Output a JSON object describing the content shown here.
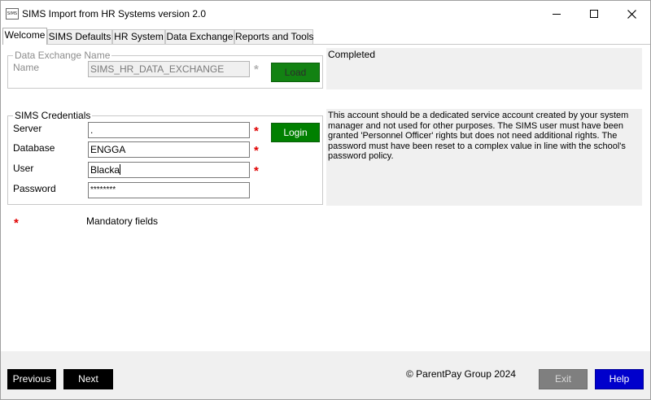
{
  "window": {
    "icon_text": "SIMS",
    "title": "SIMS Import from HR Systems  version 2.0"
  },
  "tabs": [
    {
      "label": "Welcome",
      "active": true
    },
    {
      "label": "SIMS Defaults",
      "active": false
    },
    {
      "label": "HR System",
      "active": false
    },
    {
      "label": "Data Exchange",
      "active": false
    },
    {
      "label": "Reports and Tools",
      "active": false
    }
  ],
  "data_exchange": {
    "legend": "Data Exchange Name",
    "name_label": "Name",
    "name_value": "SIMS_HR_DATA_EXCHANGE",
    "load_label": "Load",
    "status": "Completed"
  },
  "credentials": {
    "legend": "SIMS Credentials",
    "server_label": "Server",
    "server_value": ".",
    "database_label": "Database",
    "database_value": "ENGGA",
    "user_label": "User",
    "user_value": "Blacka",
    "password_label": "Password",
    "password_value": "********",
    "login_label": "Login",
    "info": "This account should be a dedicated service account created by your system manager and not used for other purposes. The SIMS user must have been granted 'Personnel Officer' rights but does not need additional rights. The password must have been reset to a complex value in line with the school's password policy."
  },
  "mandatory": {
    "star": "*",
    "text": "Mandatory fields"
  },
  "footer": {
    "previous_label": "Previous",
    "next_label": "Next",
    "copyright": "© ParentPay Group 2024",
    "exit_label": "Exit",
    "help_label": "Help"
  },
  "colors": {
    "action_green": "#008000",
    "help_blue": "#0000cc",
    "mandatory_red": "#e00000"
  }
}
